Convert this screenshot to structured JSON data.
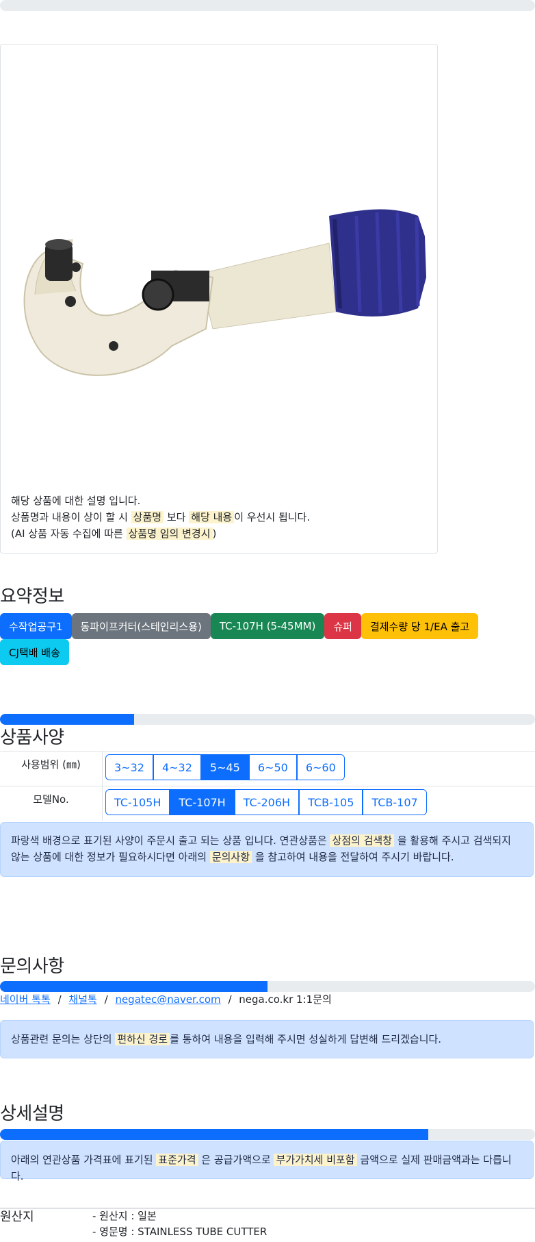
{
  "top_progress": {
    "fill": 0.0
  },
  "product_card": {
    "image_alt": "STAINLESS TUBE CUTTER",
    "desc_line1": "해당 상품에 대한 설명 입니다.",
    "desc_line2_a": "상품명과 내용이 상이 할 시",
    "desc_line2_mark1": "상품명",
    "desc_line2_b": "보다",
    "desc_line2_mark2": "해당 내용",
    "desc_line2_c": "이 우선시 됩니다.",
    "desc_line3_a": "(AI 상품 자동 수집에 따른",
    "desc_line3_mark": "상품명 임의 변경시",
    "desc_line3_b": ")"
  },
  "summary": {
    "title": "요약정보",
    "badges": [
      {
        "label": "수작업공구1",
        "color": "#0d6efd"
      },
      {
        "label": "동파이프커터(스테인리스용)",
        "color": "#6c757d"
      },
      {
        "label": "TC-107H (5-45MM)",
        "color": "#198754"
      },
      {
        "label": "슈퍼",
        "color": "#dc3545"
      },
      {
        "label": "결제수량 당 1/EA 출고",
        "color": "#ffc107"
      },
      {
        "label": "CJ택배 배송",
        "color": "#0dcaf0"
      }
    ]
  },
  "spec": {
    "progress": 0.25,
    "title": "상품사양",
    "range_label": "사용범위 (㎜)",
    "range_options": [
      "3~32",
      "4~32",
      "5~45",
      "6~50",
      "6~60"
    ],
    "range_selected": "5~45",
    "model_label": "모델No.",
    "model_options": [
      "TC-105H",
      "TC-107H",
      "TC-206H",
      "TCB-105",
      "TCB-107"
    ],
    "model_selected": "TC-107H",
    "notice_a": "파랑색 배경으로 표기된 사양이 주문시 출고 되는 상품 입니다. 연관상품은",
    "notice_mark1": "상점의 검색창",
    "notice_b": "을 활용해 주시고 검색되지 않는 상품에 대한 정보가 필요하시다면 아래의",
    "notice_mark2": "문의사항",
    "notice_c": "을 참고하여 내용을 전달하여 주시기 바랍니다."
  },
  "inquiry": {
    "title": "문의사항",
    "progress": 0.5,
    "links": [
      "네이버 톡톡",
      "채널톡",
      "negatec@naver.com"
    ],
    "separator": "/",
    "plain": "nega.co.kr 1:1문의",
    "notice_a": "상품관련 문의는 상단의",
    "notice_mark": "편하신 경로",
    "notice_b": "를 통하여 내용을 입력해 주시면 성실하게 답변해 드리겠습니다."
  },
  "detail": {
    "title": "상세설명",
    "progress": 0.8,
    "notice_a": "아래의 연관상품 가격표에 표기된",
    "notice_mark1": "표준가격",
    "notice_b": "은 공급가액으로",
    "notice_mark2": "부가가치세 비포함",
    "notice_c": "금액으로 실제 판매금액과는 다릅니다."
  },
  "origin": {
    "label": "원산지",
    "line1": "- 원산지 : 일본",
    "line2": "- 영문명 : STAINLESS TUBE CUTTER"
  }
}
